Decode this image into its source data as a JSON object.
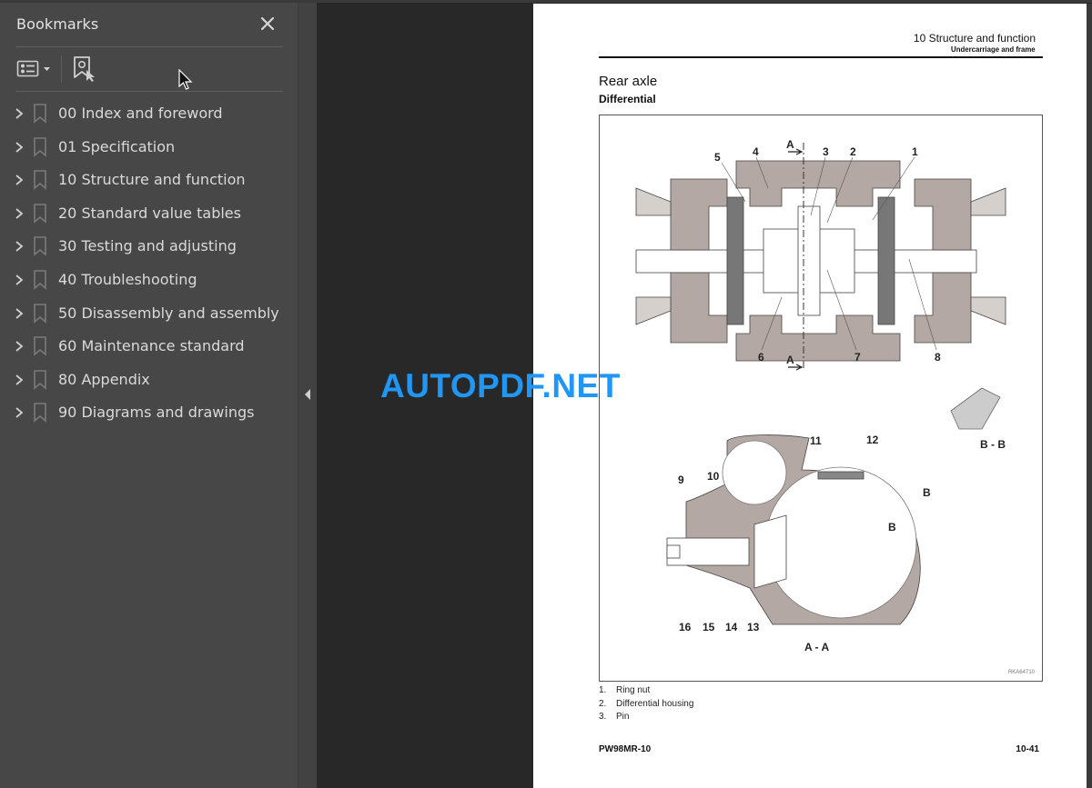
{
  "bookmarks_panel": {
    "title": "Bookmarks",
    "close_icon": "close-icon",
    "toolbar": {
      "options_icon": "list-options-icon",
      "find_icon": "find-current-bookmark-icon"
    },
    "items": [
      {
        "label": "00 Index and foreword"
      },
      {
        "label": "01 Specification"
      },
      {
        "label": "10 Structure and function"
      },
      {
        "label": "20 Standard value tables"
      },
      {
        "label": "30 Testing and adjusting"
      },
      {
        "label": "40 Troubleshooting"
      },
      {
        "label": "50 Disassembly and assembly"
      },
      {
        "label": "60 Maintenance standard"
      },
      {
        "label": "80 Appendix"
      },
      {
        "label": "90 Diagrams and drawings"
      }
    ]
  },
  "splitter": {
    "collapse_icon": "collapse-left-arrow-icon"
  },
  "watermark": {
    "text": "AUTOPDF.NET",
    "color": "#2196f3"
  },
  "page": {
    "header": {
      "chapter": "10 Structure and function",
      "section": "Undercarriage and frame"
    },
    "title": "Rear axle",
    "subtitle": "Differential",
    "figure": {
      "id": "RKA64710",
      "section_labels": [
        "A",
        "A",
        "A - A",
        "B - B",
        "B",
        "B"
      ],
      "callouts": [
        "1",
        "2",
        "3",
        "4",
        "5",
        "6",
        "7",
        "8",
        "9",
        "10",
        "11",
        "12",
        "13",
        "14",
        "15",
        "16"
      ]
    },
    "legend": [
      {
        "num": "1.",
        "text": "Ring nut"
      },
      {
        "num": "2.",
        "text": "Differential housing"
      },
      {
        "num": "3.",
        "text": "Pin"
      }
    ],
    "footer": {
      "model": "PW98MR-10",
      "page_number": "10-41"
    }
  }
}
